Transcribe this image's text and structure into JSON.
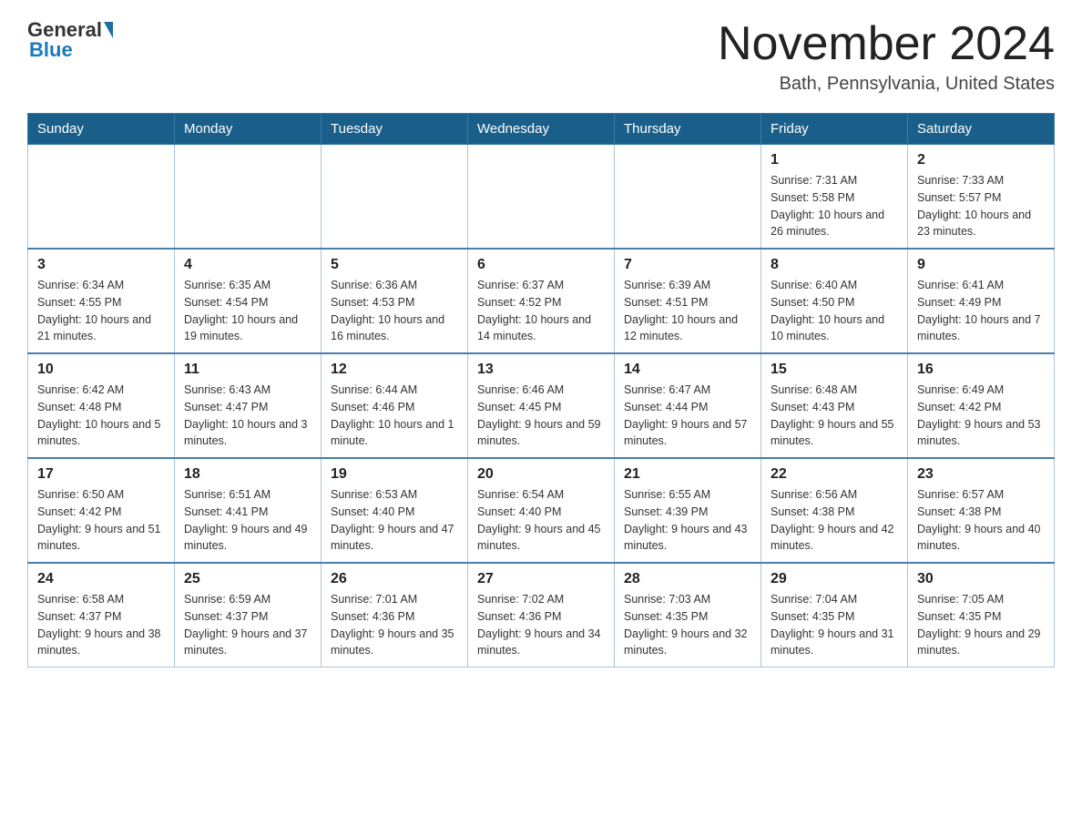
{
  "header": {
    "logo_general": "General",
    "logo_blue": "Blue",
    "month_title": "November 2024",
    "location": "Bath, Pennsylvania, United States"
  },
  "days_of_week": [
    "Sunday",
    "Monday",
    "Tuesday",
    "Wednesday",
    "Thursday",
    "Friday",
    "Saturday"
  ],
  "weeks": [
    [
      {
        "day": "",
        "info": ""
      },
      {
        "day": "",
        "info": ""
      },
      {
        "day": "",
        "info": ""
      },
      {
        "day": "",
        "info": ""
      },
      {
        "day": "",
        "info": ""
      },
      {
        "day": "1",
        "info": "Sunrise: 7:31 AM\nSunset: 5:58 PM\nDaylight: 10 hours and 26 minutes."
      },
      {
        "day": "2",
        "info": "Sunrise: 7:33 AM\nSunset: 5:57 PM\nDaylight: 10 hours and 23 minutes."
      }
    ],
    [
      {
        "day": "3",
        "info": "Sunrise: 6:34 AM\nSunset: 4:55 PM\nDaylight: 10 hours and 21 minutes."
      },
      {
        "day": "4",
        "info": "Sunrise: 6:35 AM\nSunset: 4:54 PM\nDaylight: 10 hours and 19 minutes."
      },
      {
        "day": "5",
        "info": "Sunrise: 6:36 AM\nSunset: 4:53 PM\nDaylight: 10 hours and 16 minutes."
      },
      {
        "day": "6",
        "info": "Sunrise: 6:37 AM\nSunset: 4:52 PM\nDaylight: 10 hours and 14 minutes."
      },
      {
        "day": "7",
        "info": "Sunrise: 6:39 AM\nSunset: 4:51 PM\nDaylight: 10 hours and 12 minutes."
      },
      {
        "day": "8",
        "info": "Sunrise: 6:40 AM\nSunset: 4:50 PM\nDaylight: 10 hours and 10 minutes."
      },
      {
        "day": "9",
        "info": "Sunrise: 6:41 AM\nSunset: 4:49 PM\nDaylight: 10 hours and 7 minutes."
      }
    ],
    [
      {
        "day": "10",
        "info": "Sunrise: 6:42 AM\nSunset: 4:48 PM\nDaylight: 10 hours and 5 minutes."
      },
      {
        "day": "11",
        "info": "Sunrise: 6:43 AM\nSunset: 4:47 PM\nDaylight: 10 hours and 3 minutes."
      },
      {
        "day": "12",
        "info": "Sunrise: 6:44 AM\nSunset: 4:46 PM\nDaylight: 10 hours and 1 minute."
      },
      {
        "day": "13",
        "info": "Sunrise: 6:46 AM\nSunset: 4:45 PM\nDaylight: 9 hours and 59 minutes."
      },
      {
        "day": "14",
        "info": "Sunrise: 6:47 AM\nSunset: 4:44 PM\nDaylight: 9 hours and 57 minutes."
      },
      {
        "day": "15",
        "info": "Sunrise: 6:48 AM\nSunset: 4:43 PM\nDaylight: 9 hours and 55 minutes."
      },
      {
        "day": "16",
        "info": "Sunrise: 6:49 AM\nSunset: 4:42 PM\nDaylight: 9 hours and 53 minutes."
      }
    ],
    [
      {
        "day": "17",
        "info": "Sunrise: 6:50 AM\nSunset: 4:42 PM\nDaylight: 9 hours and 51 minutes."
      },
      {
        "day": "18",
        "info": "Sunrise: 6:51 AM\nSunset: 4:41 PM\nDaylight: 9 hours and 49 minutes."
      },
      {
        "day": "19",
        "info": "Sunrise: 6:53 AM\nSunset: 4:40 PM\nDaylight: 9 hours and 47 minutes."
      },
      {
        "day": "20",
        "info": "Sunrise: 6:54 AM\nSunset: 4:40 PM\nDaylight: 9 hours and 45 minutes."
      },
      {
        "day": "21",
        "info": "Sunrise: 6:55 AM\nSunset: 4:39 PM\nDaylight: 9 hours and 43 minutes."
      },
      {
        "day": "22",
        "info": "Sunrise: 6:56 AM\nSunset: 4:38 PM\nDaylight: 9 hours and 42 minutes."
      },
      {
        "day": "23",
        "info": "Sunrise: 6:57 AM\nSunset: 4:38 PM\nDaylight: 9 hours and 40 minutes."
      }
    ],
    [
      {
        "day": "24",
        "info": "Sunrise: 6:58 AM\nSunset: 4:37 PM\nDaylight: 9 hours and 38 minutes."
      },
      {
        "day": "25",
        "info": "Sunrise: 6:59 AM\nSunset: 4:37 PM\nDaylight: 9 hours and 37 minutes."
      },
      {
        "day": "26",
        "info": "Sunrise: 7:01 AM\nSunset: 4:36 PM\nDaylight: 9 hours and 35 minutes."
      },
      {
        "day": "27",
        "info": "Sunrise: 7:02 AM\nSunset: 4:36 PM\nDaylight: 9 hours and 34 minutes."
      },
      {
        "day": "28",
        "info": "Sunrise: 7:03 AM\nSunset: 4:35 PM\nDaylight: 9 hours and 32 minutes."
      },
      {
        "day": "29",
        "info": "Sunrise: 7:04 AM\nSunset: 4:35 PM\nDaylight: 9 hours and 31 minutes."
      },
      {
        "day": "30",
        "info": "Sunrise: 7:05 AM\nSunset: 4:35 PM\nDaylight: 9 hours and 29 minutes."
      }
    ]
  ]
}
